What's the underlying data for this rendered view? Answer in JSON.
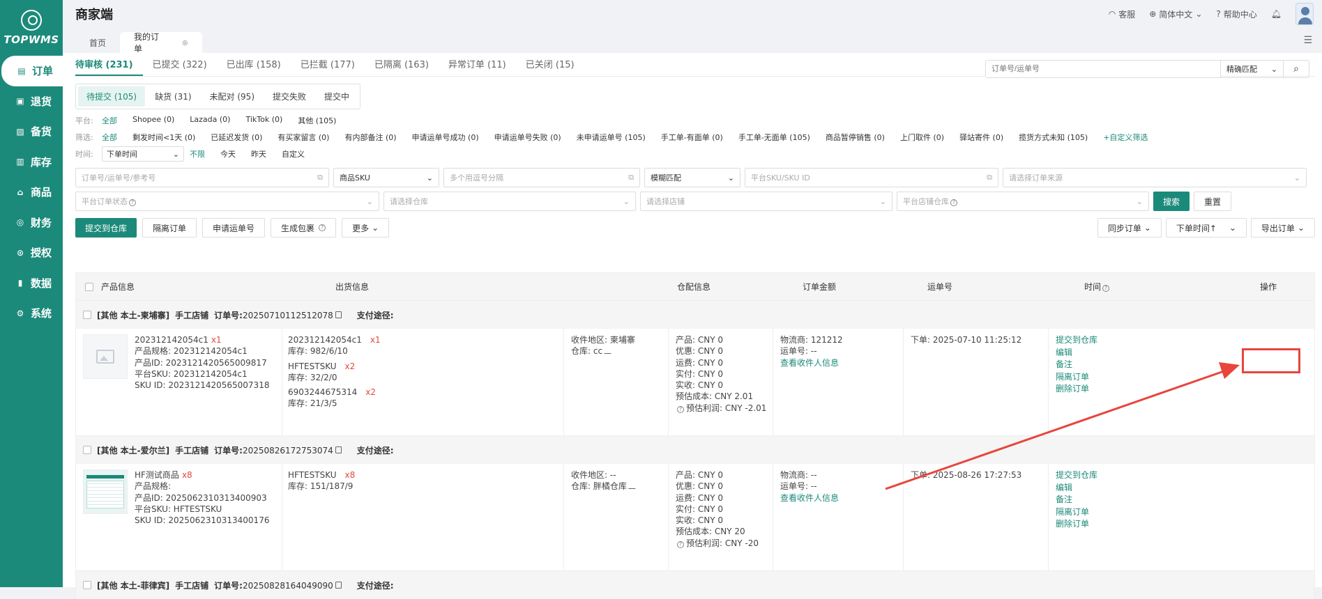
{
  "sidebar": {
    "logo_text": "TOPWMS",
    "items": [
      {
        "label": "订单",
        "icon": "order-icon",
        "glyph": "▤"
      },
      {
        "label": "退货",
        "icon": "return-icon",
        "glyph": "▣"
      },
      {
        "label": "备货",
        "icon": "stock-prep-icon",
        "glyph": "▨"
      },
      {
        "label": "库存",
        "icon": "inventory-icon",
        "glyph": "▥"
      },
      {
        "label": "商品",
        "icon": "product-icon",
        "glyph": "⌂"
      },
      {
        "label": "财务",
        "icon": "finance-icon",
        "glyph": "◎"
      },
      {
        "label": "授权",
        "icon": "auth-icon",
        "glyph": "⊙"
      },
      {
        "label": "数据",
        "icon": "chart-icon",
        "glyph": "▮"
      },
      {
        "label": "系统",
        "icon": "settings-icon",
        "glyph": "⚙"
      }
    ]
  },
  "header": {
    "title": "商家端",
    "service": "客服",
    "language": "简体中文",
    "help": "帮助中心"
  },
  "tabs": {
    "home": "首页",
    "my_orders": "我的订单"
  },
  "status_tabs": [
    "待审核 (231)",
    "已提交 (322)",
    "已出库 (158)",
    "已拦截 (177)",
    "已隔离 (163)",
    "异常订单 (11)",
    "已关闭 (15)"
  ],
  "order_search": {
    "placeholder": "订单号/运单号",
    "mode": "精确匹配"
  },
  "sub_tabs": [
    "待提交 (105)",
    "缺货 (31)",
    "未配对 (95)",
    "提交失败",
    "提交中"
  ],
  "platform_filter": {
    "label": "平台:",
    "options": [
      "全部",
      "Shopee (0)",
      "Lazada (0)",
      "TikTok (0)",
      "其他 (105)"
    ]
  },
  "screen_filter": {
    "label": "筛选:",
    "options": [
      "全部",
      "剩发时间<1天 (0)",
      "已延迟发货 (0)",
      "有买家留言 (0)",
      "有内部备注 (0)",
      "申请运单号成功 (0)",
      "申请运单号失败 (0)",
      "未申请运单号 (105)",
      "手工单-有面单 (0)",
      "手工单-无面单 (105)",
      "商品暂停销售 (0)",
      "上门取件 (0)",
      "驿站寄件 (0)",
      "揽货方式未知 (105)"
    ],
    "custom": "+自定义筛选"
  },
  "time_filter": {
    "label": "时间:",
    "select": "下单时间",
    "options": [
      "不限",
      "今天",
      "昨天",
      "自定义"
    ]
  },
  "search_fields": {
    "order_ref": "订单号/运单号/参考号",
    "sku_type": "商品SKU",
    "multi": "多个用逗号分隔",
    "match": "模糊匹配",
    "platform_sku": "平台SKU/SKU ID",
    "source": "请选择订单来源",
    "platform_status": "平台订单状态",
    "warehouse": "请选择仓库",
    "shop": "请选择店铺",
    "platform_wh": "平台店铺仓库",
    "search_btn": "搜索",
    "reset_btn": "重置"
  },
  "actions": {
    "submit": "提交到仓库",
    "isolate": "隔离订单",
    "apply": "申请运单号",
    "package": "生成包裹",
    "more": "更多",
    "sync": "同步订单",
    "sort": "下单时间↑",
    "export": "导出订单"
  },
  "columns": {
    "product": "产品信息",
    "shipping": "出货信息",
    "warehouse": "仓配信息",
    "amount": "订单金额",
    "tracking": "运单号",
    "time": "时间",
    "ops": "操作"
  },
  "orders": [
    {
      "tag": "[其他 本土-柬埔寨]",
      "shop": "手工店铺",
      "order_no_label": "订单号:",
      "order_no": "20250710112512078",
      "pay_label": "支付途径:",
      "product_sku": "202312142054c1",
      "product_qty": "x1",
      "product_spec": "产品规格: 202312142054c1",
      "product_id": "产品ID: 2023121420565009817",
      "platform_sku": "平台SKU: 202312142054c1",
      "sku_id": "SKU ID: 2023121420565007318",
      "ship_lines": [
        {
          "sku": "202312142054c1",
          "qty": "x1",
          "stock": "库存: 982/6/10"
        },
        {
          "sku": "HFTESTSKU",
          "qty": "x2",
          "stock": "库存: 32/2/0"
        },
        {
          "sku": "6903244675314",
          "qty": "x2",
          "stock": "库存: 21/3/5"
        }
      ],
      "region": "收件地区: 柬埔寨",
      "warehouse": "仓库: cc",
      "amounts": [
        "产品: CNY 0",
        "优惠: CNY 0",
        "运费: CNY 0",
        "实付: CNY 0",
        "实收: CNY 0",
        "预估成本: CNY 2.01",
        "预估利润: CNY -2.01"
      ],
      "carrier": "物流商: 121212",
      "tracking": "运单号: --",
      "view_receiver": "查看收件人信息",
      "time": "下单: 2025-07-10 11:25:12",
      "ops": [
        "提交到仓库",
        "编辑",
        "备注",
        "隔离订单",
        "删除订单"
      ]
    },
    {
      "tag": "[其他 本土-爱尔兰]",
      "shop": "手工店铺",
      "order_no_label": "订单号:",
      "order_no": "20250826172753074",
      "pay_label": "支付途径:",
      "product_sku": "HF测试商品",
      "product_qty": "x8",
      "product_spec": "产品规格:",
      "product_id": "产品ID: 2025062310313400903",
      "platform_sku": "平台SKU: HFTESTSKU",
      "sku_id": "SKU ID: 2025062310313400176",
      "ship_lines": [
        {
          "sku": "HFTESTSKU",
          "qty": "x8",
          "stock": "库存: 151/187/9"
        }
      ],
      "region": "收件地区: --",
      "warehouse": "仓库: 胖橘仓库",
      "amounts": [
        "产品: CNY 0",
        "优惠: CNY 0",
        "运费: CNY 0",
        "实付: CNY 0",
        "实收: CNY 0",
        "预估成本: CNY 20",
        "预估利润: CNY -20"
      ],
      "carrier": "物流商: --",
      "tracking": "运单号: --",
      "view_receiver": "查看收件人信息",
      "time": "下单: 2025-08-26 17:27:53",
      "ops": [
        "提交到仓库",
        "编辑",
        "备注",
        "隔离订单",
        "删除订单"
      ]
    }
  ],
  "partial_row": {
    "tag": "[其他 本土-菲律宾]",
    "shop": "手工店铺",
    "order_no_label": "订单号:",
    "order_no": "20250828164049090",
    "pay_label": "支付途径:"
  },
  "colors": {
    "accent": "#1c8a7a",
    "annotation": "#e8453c"
  }
}
